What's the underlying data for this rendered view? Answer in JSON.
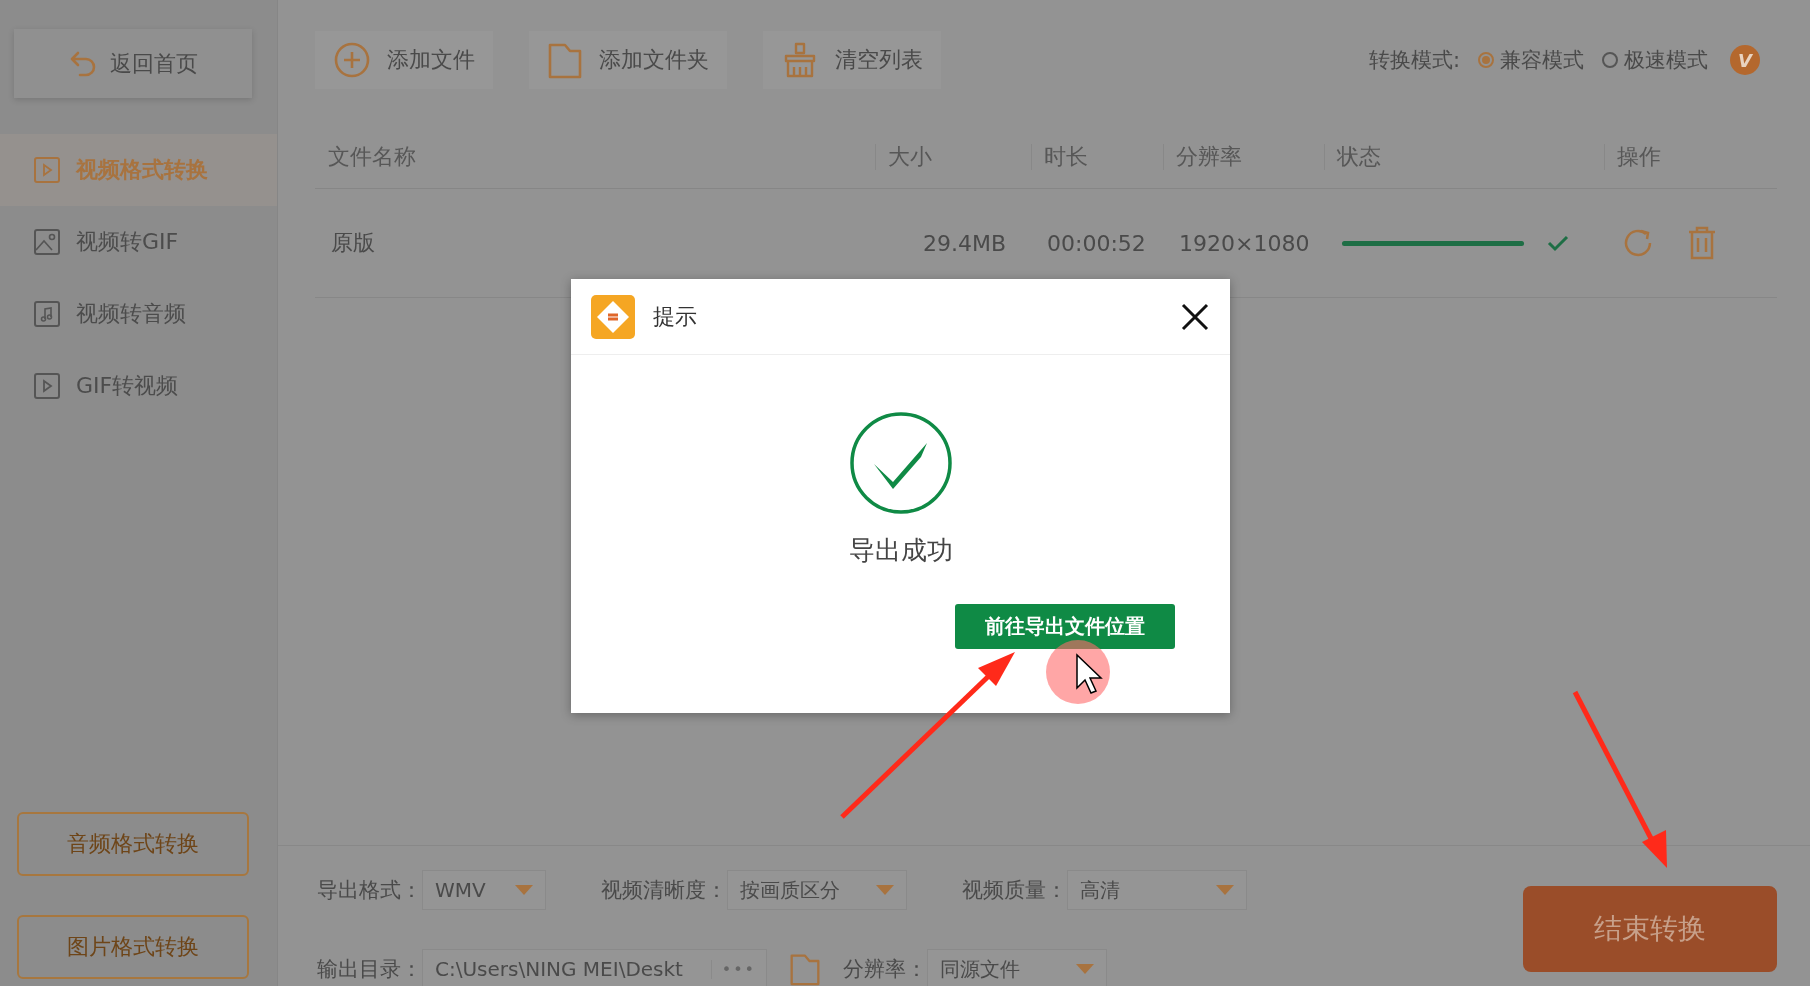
{
  "sidebar": {
    "back_button": "返回首页",
    "items": [
      {
        "kind": "video",
        "label": "视频格式转换",
        "selected": true
      },
      {
        "kind": "image",
        "label": "视频转GIF",
        "selected": false
      },
      {
        "kind": "music",
        "label": "视频转音频",
        "selected": false
      },
      {
        "kind": "video",
        "label": "GIF转视频",
        "selected": false
      }
    ],
    "bottom_buttons": [
      "音频格式转换",
      "图片格式转换"
    ]
  },
  "toolbar": {
    "buttons": [
      {
        "kind": "add",
        "label": "添加文件"
      },
      {
        "kind": "folder",
        "label": "添加文件夹"
      },
      {
        "kind": "clear",
        "label": "清空列表"
      }
    ],
    "mode": {
      "label": "转换模式:",
      "options": [
        {
          "label": "兼容模式",
          "selected": true
        },
        {
          "label": "极速模式",
          "selected": false
        }
      ],
      "badge": "V"
    }
  },
  "table": {
    "columns": [
      "文件名称",
      "大小",
      "时长",
      "分辨率",
      "状态",
      "操作"
    ],
    "rows": [
      {
        "name": "原版",
        "size": "29.4MB",
        "duration": "00:00:52",
        "resolution": "1920×1080",
        "level": 1,
        "done": true
      }
    ]
  },
  "dialog": {
    "title": "提示",
    "message": "导出成功",
    "button": "前往导出文件位置"
  },
  "settings": {
    "row_1": [
      {
        "label": "导出格式：",
        "value": "WMV"
      },
      {
        "label": "视频清晰度：",
        "value": "按画质区分"
      },
      {
        "label": "视频质量：",
        "value": "高清"
      }
    ],
    "output_dir": {
      "label": "输出目录：",
      "value": "C:\\Users\\NING MEI\\Deskt",
      "more": "•••"
    },
    "resolution": {
      "label": "分辨率：",
      "value": "同源文件"
    }
  },
  "end_button": "结束转换"
}
